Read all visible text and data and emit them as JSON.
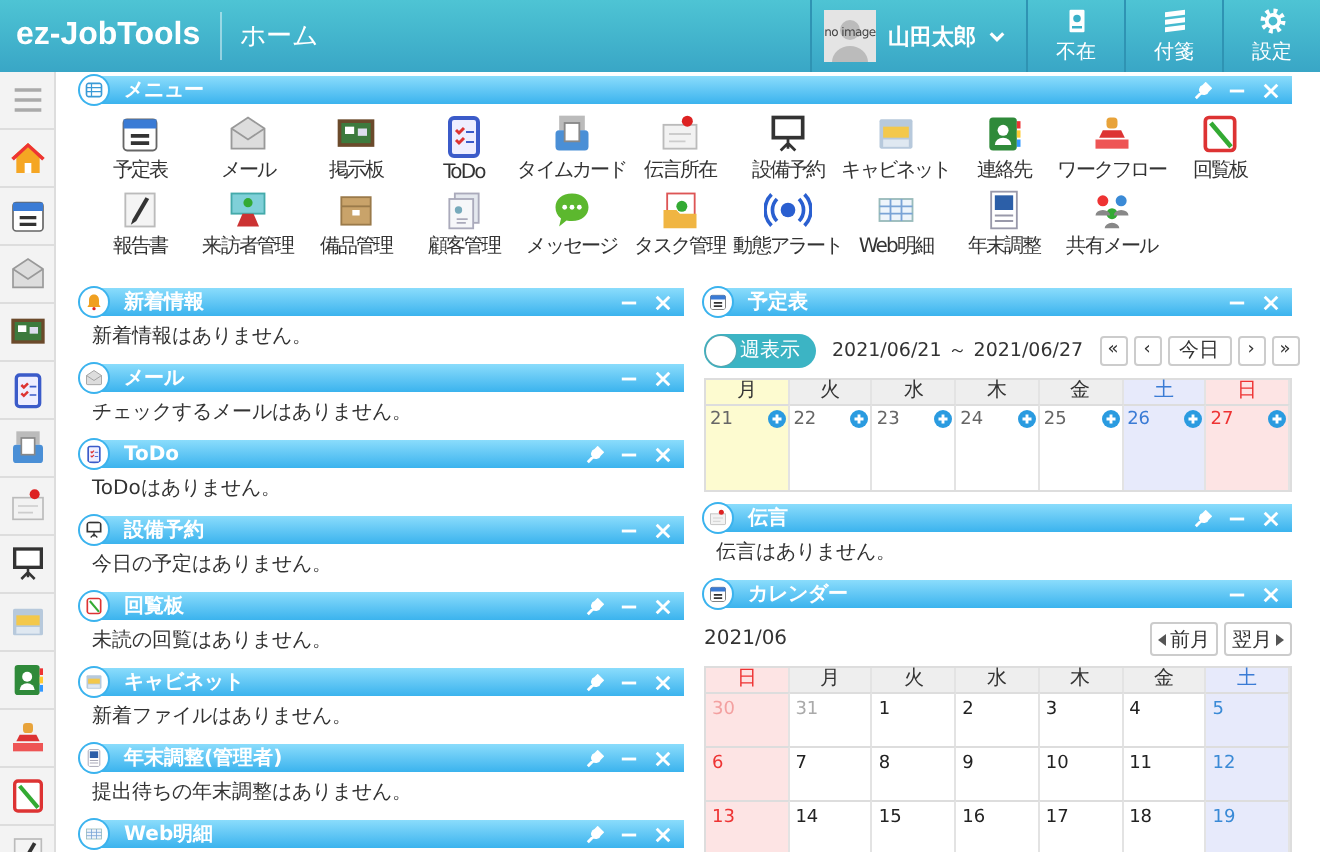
{
  "header": {
    "logo": "ez-JobTools",
    "page_title": "ホーム",
    "avatar_text": "no image",
    "user_name": "山田太郎",
    "actions": [
      {
        "label": "不在",
        "kind": "absent"
      },
      {
        "label": "付箋",
        "kind": "sticky"
      },
      {
        "label": "設定",
        "kind": "settings"
      }
    ]
  },
  "sidebar": {
    "items": [
      {
        "kind": "menu"
      },
      {
        "kind": "home"
      },
      {
        "kind": "calendar"
      },
      {
        "kind": "mail"
      },
      {
        "kind": "board"
      },
      {
        "kind": "todo"
      },
      {
        "kind": "timecard"
      },
      {
        "kind": "dengon"
      },
      {
        "kind": "equipment"
      },
      {
        "kind": "cabinet"
      },
      {
        "kind": "address"
      },
      {
        "kind": "workflow"
      },
      {
        "kind": "circular"
      },
      {
        "kind": "report"
      }
    ]
  },
  "menu_panel": {
    "title": "メニュー",
    "kind": "grid",
    "has_settings": true,
    "items": [
      {
        "label": "予定表",
        "kind": "calendar"
      },
      {
        "label": "メール",
        "kind": "mail"
      },
      {
        "label": "掲示板",
        "kind": "board"
      },
      {
        "label": "ToDo",
        "kind": "todo"
      },
      {
        "label": "タイムカード",
        "kind": "timecard"
      },
      {
        "label": "伝言所在",
        "kind": "dengon"
      },
      {
        "label": "設備予約",
        "kind": "equipment"
      },
      {
        "label": "キャビネット",
        "kind": "cabinet"
      },
      {
        "label": "連絡先",
        "kind": "address"
      },
      {
        "label": "ワークフロー",
        "kind": "workflow"
      },
      {
        "label": "回覧板",
        "kind": "circular"
      },
      {
        "label": "報告書",
        "kind": "report"
      },
      {
        "label": "来訪者管理",
        "kind": "visitor"
      },
      {
        "label": "備品管理",
        "kind": "inventory"
      },
      {
        "label": "顧客管理",
        "kind": "customer"
      },
      {
        "label": "メッセージ",
        "kind": "message"
      },
      {
        "label": "タスク管理",
        "kind": "task"
      },
      {
        "label": "動態アラート",
        "kind": "alert"
      },
      {
        "label": "Web明細",
        "kind": "webpay"
      },
      {
        "label": "年末調整",
        "kind": "yearend"
      },
      {
        "label": "共有メール",
        "kind": "sharedmail"
      }
    ]
  },
  "left_panels": [
    {
      "title": "新着情報",
      "kind": "info",
      "has_settings": false,
      "message": "新着情報はありません。"
    },
    {
      "title": "メール",
      "kind": "mail",
      "has_settings": false,
      "message": "チェックするメールはありません。"
    },
    {
      "title": "ToDo",
      "kind": "todo",
      "has_settings": true,
      "message": "ToDoはありません。"
    },
    {
      "title": "設備予約",
      "kind": "equipment",
      "has_settings": false,
      "message": "今日の予定はありません。"
    },
    {
      "title": "回覧板",
      "kind": "circular",
      "has_settings": true,
      "message": "未読の回覧はありません。"
    },
    {
      "title": "キャビネット",
      "kind": "cabinet",
      "has_settings": true,
      "message": "新着ファイルはありません。"
    },
    {
      "title": "年末調整(管理者)",
      "kind": "yearend",
      "has_settings": true,
      "message": "提出待ちの年末調整はありません。"
    },
    {
      "title": "Web明細",
      "kind": "webpay",
      "has_settings": true
    }
  ],
  "schedule": {
    "title": "予定表",
    "kind": "calendar",
    "has_settings": false,
    "toggle": {
      "label": "週表示"
    },
    "range": "2021/06/21 ～ 2021/06/27",
    "nav": [
      "«",
      "‹",
      "今日",
      "›",
      "»"
    ],
    "days": [
      {
        "label": "月",
        "day": "21",
        "kind": "weekday",
        "selected": true
      },
      {
        "label": "火",
        "day": "22",
        "kind": "weekday",
        "selected": false
      },
      {
        "label": "水",
        "day": "23",
        "kind": "weekday",
        "selected": false
      },
      {
        "label": "木",
        "day": "24",
        "kind": "weekday",
        "selected": false
      },
      {
        "label": "金",
        "day": "25",
        "kind": "weekday",
        "selected": false
      },
      {
        "label": "土",
        "day": "26",
        "kind": "sat",
        "selected": false
      },
      {
        "label": "日",
        "day": "27",
        "kind": "sun",
        "selected": false
      }
    ]
  },
  "dengon_panel": {
    "title": "伝言",
    "kind": "dengon",
    "has_settings": true,
    "message": "伝言はありません。"
  },
  "calendar": {
    "title": "カレンダー",
    "kind": "calendar",
    "has_settings": false,
    "month": "2021/06",
    "prev": "前月",
    "next": "翌月",
    "weekdays": [
      {
        "label": "日",
        "kind": "sun"
      },
      {
        "label": "月",
        "kind": "weekday"
      },
      {
        "label": "火",
        "kind": "weekday"
      },
      {
        "label": "水",
        "kind": "weekday"
      },
      {
        "label": "木",
        "kind": "weekday"
      },
      {
        "label": "金",
        "kind": "weekday"
      },
      {
        "label": "土",
        "kind": "sat"
      }
    ],
    "weeks": [
      [
        {
          "day": "30",
          "kind": "sun",
          "other_month": true
        },
        {
          "day": "31",
          "kind": "weekday",
          "other_month": true
        },
        {
          "day": "1",
          "kind": "weekday",
          "other_month": false
        },
        {
          "day": "2",
          "kind": "weekday",
          "other_month": false
        },
        {
          "day": "3",
          "kind": "weekday",
          "other_month": false
        },
        {
          "day": "4",
          "kind": "weekday",
          "other_month": false
        },
        {
          "day": "5",
          "kind": "sat",
          "other_month": false
        }
      ],
      [
        {
          "day": "6",
          "kind": "sun",
          "other_month": false
        },
        {
          "day": "7",
          "kind": "weekday",
          "other_month": false
        },
        {
          "day": "8",
          "kind": "weekday",
          "other_month": false
        },
        {
          "day": "9",
          "kind": "weekday",
          "other_month": false
        },
        {
          "day": "10",
          "kind": "weekday",
          "other_month": false
        },
        {
          "day": "11",
          "kind": "weekday",
          "other_month": false
        },
        {
          "day": "12",
          "kind": "sat",
          "other_month": false
        }
      ],
      [
        {
          "day": "13",
          "kind": "sun",
          "other_month": false
        },
        {
          "day": "14",
          "kind": "weekday",
          "other_month": false
        },
        {
          "day": "15",
          "kind": "weekday",
          "other_month": false
        },
        {
          "day": "16",
          "kind": "weekday",
          "other_month": false
        },
        {
          "day": "17",
          "kind": "weekday",
          "other_month": false
        },
        {
          "day": "18",
          "kind": "weekday",
          "other_month": false
        },
        {
          "day": "19",
          "kind": "sat",
          "other_month": false
        }
      ]
    ]
  }
}
